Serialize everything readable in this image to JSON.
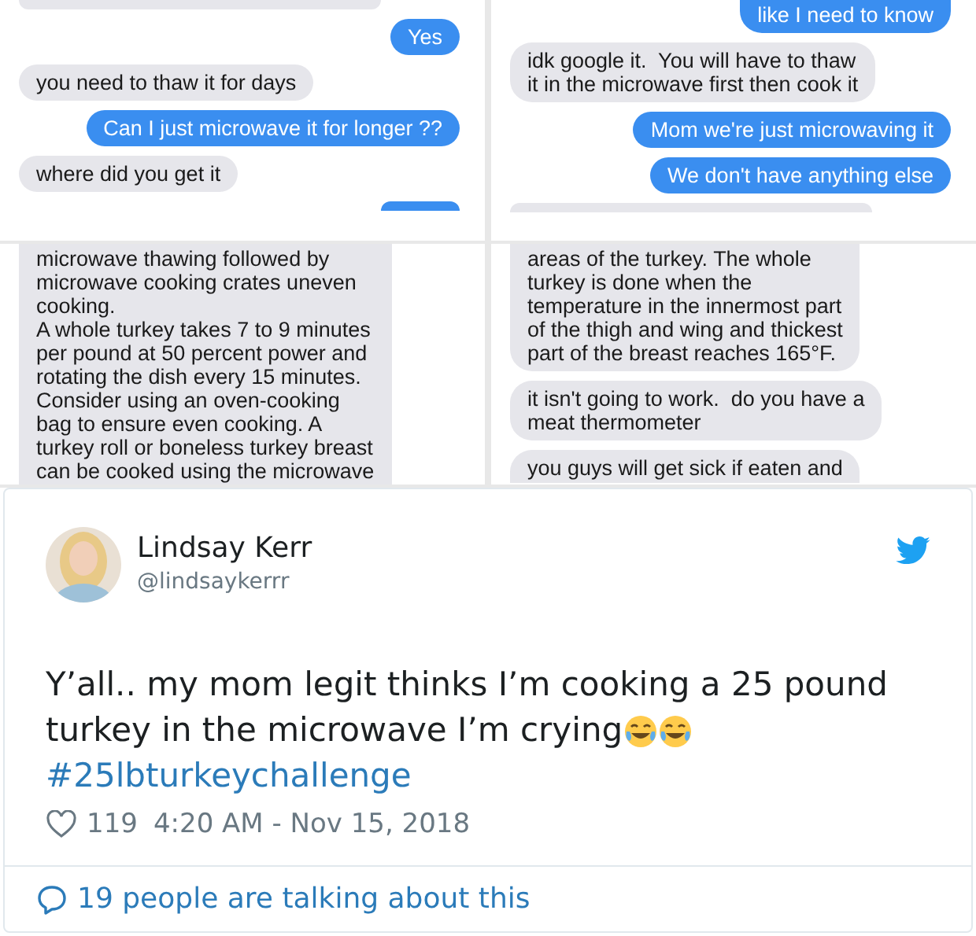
{
  "screenshot_rows": [
    {
      "screenshots": [
        {
          "messages": [
            {
              "kind": "received"
            },
            {
              "kind": "sent",
              "text": "Yes"
            },
            {
              "kind": "received",
              "text": "you need to thaw it for days"
            },
            {
              "kind": "sent",
              "text": "Can I just microwave it for longer ??"
            },
            {
              "kind": "received",
              "text": "where did you get it"
            },
            {
              "kind": "sent"
            }
          ]
        },
        {
          "messages": [
            {
              "kind": "sent",
              "text": "like I need to know"
            },
            {
              "kind": "received",
              "text": "idk google it.  You will have to thaw\nit in the microwave first then cook it"
            },
            {
              "kind": "sent",
              "text": "Mom we're just microwaving it"
            },
            {
              "kind": "sent",
              "text": "We don't have anything else"
            },
            {
              "kind": "received"
            }
          ]
        }
      ]
    },
    {
      "screenshots": [
        {
          "messages": [
            {
              "kind": "received",
              "text": "microwave thawing followed by\nmicrowave cooking crates uneven\ncooking.\nA whole turkey takes 7 to 9 minutes\nper pound at 50 percent power and\nrotating the dish every 15 minutes.\nConsider using an oven-cooking\nbag to ensure even cooking. A\nturkey roll or boneless turkey breast\ncan be cooked using the microwave"
            }
          ]
        },
        {
          "messages": [
            {
              "kind": "received",
              "text": "areas of the turkey. The whole\nturkey is done when the\ntemperature in the innermost part\nof the thigh and wing and thickest\npart of the breast reaches 165°F."
            },
            {
              "kind": "received",
              "text": "it isn't going to work.  do you have a\nmeat thermometer"
            },
            {
              "kind": "received",
              "text": "you guys will get sick if eaten and"
            }
          ]
        }
      ]
    }
  ],
  "tweet": {
    "author": "Lindsay Kerr",
    "handle": "@lindsaykerrr",
    "text_lines": [
      "Y’all.. my mom legit thinks I’m cooking a 25 pound",
      "turkey in the microwave I’m crying"
    ],
    "emojis": [
      {
        "kind": "laughing"
      },
      {
        "kind": "laughing"
      }
    ],
    "hashtag": "#25lbturkeychallenge",
    "likes": "119",
    "timestamp": "4:20 AM - Nov 15, 2018",
    "footer": "19 people are talking about this"
  }
}
